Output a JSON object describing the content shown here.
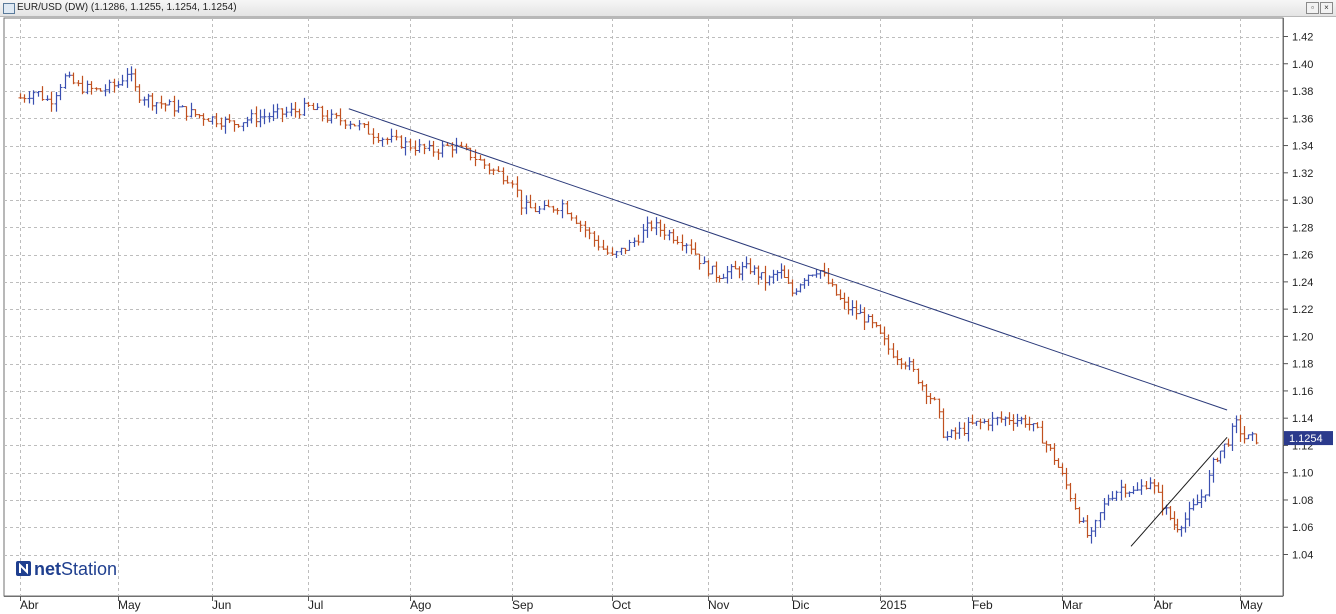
{
  "window": {
    "title": "EUR/USD (DW) (1.1286, 1.1255, 1.1254, 1.1254)",
    "restore_glyph": "▫",
    "close_glyph": "×"
  },
  "chart_data": {
    "type": "ohlc",
    "instrument": "EUR/USD (DW)",
    "last_value": "1.1254",
    "y_ticks": [
      "1.04",
      "1.06",
      "1.08",
      "1.10",
      "1.12",
      "1.14",
      "1.16",
      "1.18",
      "1.20",
      "1.22",
      "1.24",
      "1.26",
      "1.28",
      "1.30",
      "1.32",
      "1.34",
      "1.36",
      "1.38",
      "1.40",
      "1.42"
    ],
    "ylim": [
      1.02,
      1.43
    ],
    "x_labels": [
      "Abr",
      "May",
      "Jun",
      "Jul",
      "Ago",
      "Sep",
      "Oct",
      "Nov",
      "Dic",
      "2015",
      "Feb",
      "Mar",
      "Abr",
      "May"
    ],
    "grid": true,
    "colors": {
      "up": "#3a4fb0",
      "down": "#c0501f",
      "trendline": "#2b3a7a",
      "support": "#1a1a1a",
      "last_box": "#2b3a8c"
    },
    "trendlines": [
      {
        "from": {
          "x_month": 3.4,
          "y": 1.367
        },
        "to": {
          "x_month": 12.85,
          "y": 1.146
        }
      },
      {
        "from": {
          "x_month": 11.75,
          "y": 1.046
        },
        "to": {
          "x_month": 12.85,
          "y": 1.126
        }
      }
    ],
    "price_path": [
      [
        0.0,
        1.375
      ],
      [
        0.15,
        1.38
      ],
      [
        0.3,
        1.372
      ],
      [
        0.45,
        1.39
      ],
      [
        0.6,
        1.383
      ],
      [
        0.8,
        1.38
      ],
      [
        1.0,
        1.385
      ],
      [
        1.1,
        1.395
      ],
      [
        1.2,
        1.378
      ],
      [
        1.4,
        1.372
      ],
      [
        1.6,
        1.368
      ],
      [
        1.8,
        1.363
      ],
      [
        2.0,
        1.36
      ],
      [
        2.2,
        1.356
      ],
      [
        2.4,
        1.36
      ],
      [
        2.6,
        1.362
      ],
      [
        2.85,
        1.365
      ],
      [
        3.0,
        1.368
      ],
      [
        3.2,
        1.36
      ],
      [
        3.4,
        1.358
      ],
      [
        3.55,
        1.352
      ],
      [
        3.75,
        1.345
      ],
      [
        4.0,
        1.34
      ],
      [
        4.2,
        1.336
      ],
      [
        4.4,
        1.34
      ],
      [
        4.6,
        1.333
      ],
      [
        4.8,
        1.322
      ],
      [
        5.0,
        1.315
      ],
      [
        5.1,
        1.295
      ],
      [
        5.3,
        1.292
      ],
      [
        5.5,
        1.297
      ],
      [
        5.65,
        1.285
      ],
      [
        5.8,
        1.272
      ],
      [
        6.0,
        1.258
      ],
      [
        6.2,
        1.268
      ],
      [
        6.4,
        1.282
      ],
      [
        6.6,
        1.275
      ],
      [
        6.8,
        1.268
      ],
      [
        6.95,
        1.252
      ],
      [
        7.1,
        1.245
      ],
      [
        7.3,
        1.248
      ],
      [
        7.5,
        1.25
      ],
      [
        7.7,
        1.24
      ],
      [
        7.85,
        1.248
      ],
      [
        8.0,
        1.232
      ],
      [
        8.15,
        1.245
      ],
      [
        8.3,
        1.25
      ],
      [
        8.45,
        1.235
      ],
      [
        8.6,
        1.222
      ],
      [
        8.8,
        1.215
      ],
      [
        8.95,
        1.205
      ],
      [
        9.1,
        1.19
      ],
      [
        9.3,
        1.18
      ],
      [
        9.45,
        1.165
      ],
      [
        9.6,
        1.15
      ],
      [
        9.7,
        1.125
      ],
      [
        9.85,
        1.13
      ],
      [
        10.0,
        1.135
      ],
      [
        10.2,
        1.138
      ],
      [
        10.4,
        1.14
      ],
      [
        10.6,
        1.138
      ],
      [
        10.75,
        1.128
      ],
      [
        10.9,
        1.112
      ],
      [
        11.05,
        1.09
      ],
      [
        11.2,
        1.065
      ],
      [
        11.3,
        1.05
      ],
      [
        11.4,
        1.068
      ],
      [
        11.5,
        1.082
      ],
      [
        11.65,
        1.09
      ],
      [
        11.8,
        1.085
      ],
      [
        11.95,
        1.095
      ],
      [
        12.05,
        1.082
      ],
      [
        12.15,
        1.07
      ],
      [
        12.25,
        1.06
      ],
      [
        12.35,
        1.065
      ],
      [
        12.5,
        1.078
      ],
      [
        12.6,
        1.088
      ],
      [
        12.7,
        1.11
      ],
      [
        12.85,
        1.122
      ],
      [
        12.95,
        1.136
      ],
      [
        13.05,
        1.125
      ],
      [
        13.2,
        1.125
      ]
    ]
  }
}
